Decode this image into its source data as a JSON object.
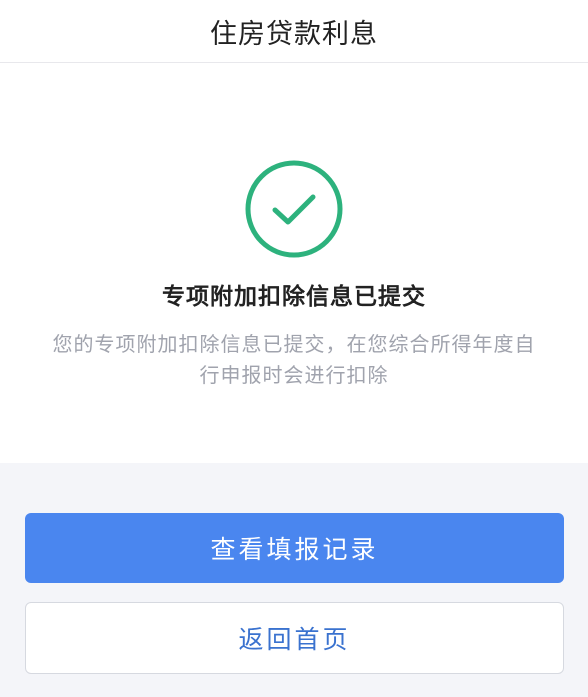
{
  "header": {
    "title": "住房贷款利息"
  },
  "result": {
    "icon": "check-circle-icon",
    "icon_color": "#2db27d",
    "title": "专项附加扣除信息已提交",
    "description": "您的专项附加扣除信息已提交，在您综合所得年度自行申报时会进行扣除"
  },
  "actions": {
    "view_records_label": "查看填报记录",
    "back_home_label": "返回首页"
  },
  "colors": {
    "primary": "#4a86ef",
    "secondary_text": "#3a72cf",
    "success": "#2db27d"
  }
}
